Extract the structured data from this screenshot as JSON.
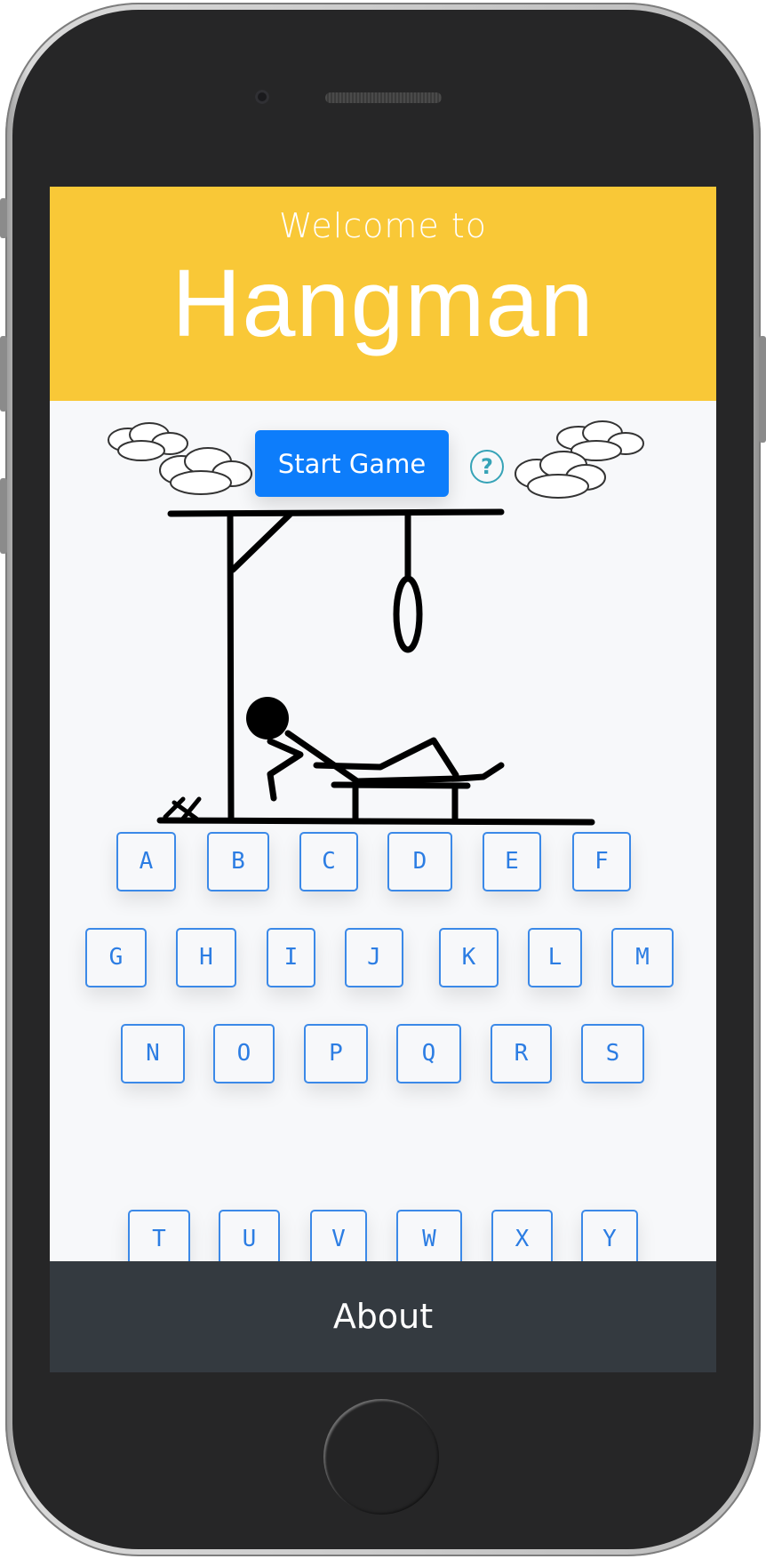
{
  "header": {
    "welcome": "Welcome to",
    "title": "Hangman"
  },
  "actions": {
    "start_label": "Start Game",
    "help_label": "?"
  },
  "keyboard": {
    "rows": [
      [
        "A",
        "B",
        "C",
        "D",
        "E",
        "F"
      ],
      [
        "G",
        "H",
        "I",
        "J",
        "K",
        "L",
        "M"
      ],
      [
        "N",
        "O",
        "P",
        "Q",
        "R",
        "S"
      ],
      [
        "T",
        "U",
        "V",
        "W",
        "X",
        "Y"
      ]
    ]
  },
  "footer": {
    "about_label": "About"
  },
  "colors": {
    "banner": "#f9c837",
    "primary": "#0d7dfb",
    "footer": "#343a40",
    "key_outline": "#3b89e8"
  }
}
